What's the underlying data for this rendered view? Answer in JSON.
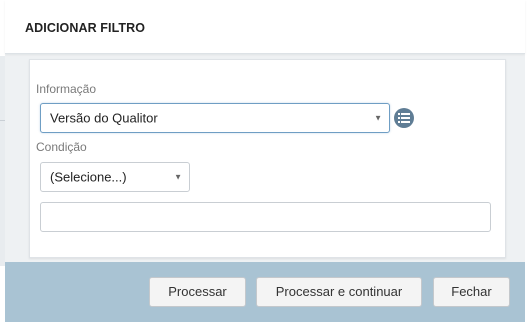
{
  "dialog": {
    "title": "ADICIONAR FILTRO"
  },
  "form": {
    "informacao": {
      "label": "Informação",
      "value": "Versão do Qualitor"
    },
    "condicao": {
      "label": "Condição",
      "value": "(Selecione...)"
    },
    "text_input": {
      "value": "",
      "placeholder": ""
    },
    "list_icon": "list-icon"
  },
  "footer": {
    "processar_label": "Processar",
    "processar_continuar_label": "Processar e continuar",
    "fechar_label": "Fechar"
  },
  "colors": {
    "footer_bg": "#a9c3d3",
    "icon_button": "#5f7d95",
    "focus_border": "#6f9ec4"
  }
}
